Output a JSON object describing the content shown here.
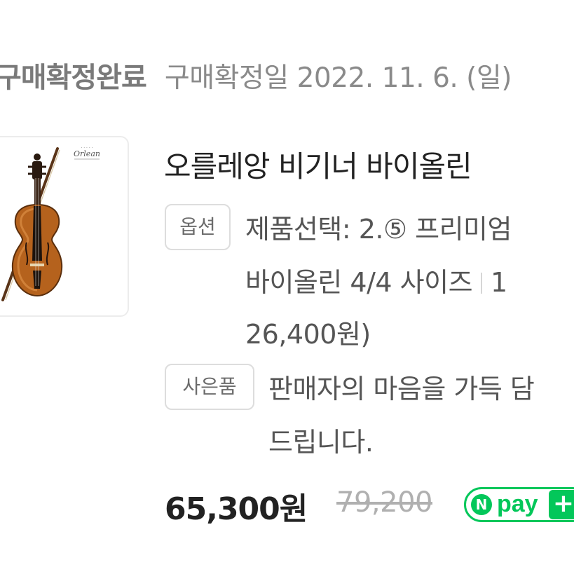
{
  "order": {
    "status": "구매확정완료",
    "confirm_date": "구매확정일 2022. 11. 6. (일)"
  },
  "product": {
    "logo_text": "Orlean",
    "title": "오를레앙 비기너 바이올린",
    "option_badge": "옵션",
    "option_line1": "제품선택: 2.⑤ 프리미엄",
    "option_line2": "바이올린 4/4 사이즈",
    "option_line2_tail": "1",
    "option_line3": "26,400원)",
    "gift_badge": "사은품",
    "gift_line1": "판매자의 마음을 가득 담",
    "gift_line2": "드립니다.",
    "price": "65,300원",
    "original_price": "79,200",
    "npay_n": "N",
    "npay_text": "pay",
    "npay_plus": "+"
  },
  "colors": {
    "npay_green": "#03c75a",
    "violin_body": "#b5621d"
  }
}
